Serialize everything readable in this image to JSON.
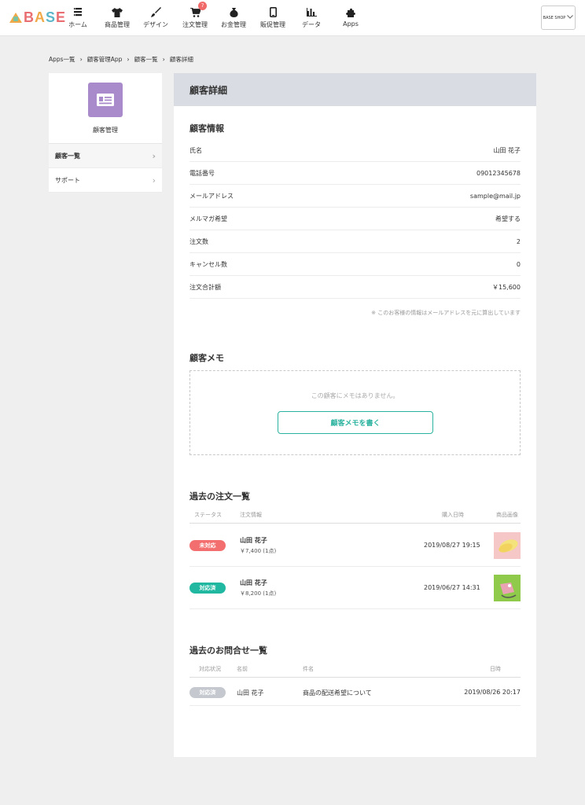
{
  "brand": {
    "logo_text": [
      "B",
      "A",
      "S",
      "E"
    ]
  },
  "nav": {
    "items": [
      {
        "label": "ホーム",
        "icon": "home-list-icon"
      },
      {
        "label": "商品管理",
        "icon": "tshirt-icon"
      },
      {
        "label": "デザイン",
        "icon": "brush-icon"
      },
      {
        "label": "注文管理",
        "icon": "cart-icon",
        "badge": "7"
      },
      {
        "label": "お金管理",
        "icon": "money-bag-icon"
      },
      {
        "label": "販促管理",
        "icon": "phone-icon"
      },
      {
        "label": "データ",
        "icon": "bar-chart-icon"
      },
      {
        "label": "Apps",
        "icon": "puzzle-icon"
      }
    ],
    "shop_button": "BASE SHOP"
  },
  "breadcrumb": [
    "Apps一覧",
    "顧客管理App",
    "顧客一覧",
    "顧客詳細"
  ],
  "sidebar": {
    "title": "顧客管理",
    "items": [
      {
        "label": "顧客一覧"
      },
      {
        "label": "サポート"
      }
    ]
  },
  "main": {
    "heading": "顧客詳細",
    "info": {
      "title": "顧客情報",
      "rows": [
        {
          "label": "氏名",
          "value": "山田 花子"
        },
        {
          "label": "電話番号",
          "value": "09012345678"
        },
        {
          "label": "メールアドレス",
          "value": "sample@mail.jp"
        },
        {
          "label": "メルマガ希望",
          "value": "希望する"
        },
        {
          "label": "注文数",
          "value": "2"
        },
        {
          "label": "キャンセル数",
          "value": "0"
        },
        {
          "label": "注文合計額",
          "value": "￥15,600"
        }
      ],
      "note": "※ このお客様の情報はメールアドレスを元に算出しています"
    },
    "memo": {
      "title": "顧客メモ",
      "empty_text": "この顧客にメモはありません。",
      "button": "顧客メモを書く"
    },
    "orders": {
      "title": "過去の注文一覧",
      "headers": [
        "ステータス",
        "注文情報",
        "購入日時",
        "商品画像"
      ],
      "rows": [
        {
          "status": "未対応",
          "name": "山田 花子",
          "price": "￥7,400 (1点)",
          "date": "2019/08/27 19:15",
          "status_color": "#f36f6f"
        },
        {
          "status": "対応済",
          "name": "山田 花子",
          "price": "￥8,200 (1点)",
          "date": "2019/06/27 14:31",
          "status_color": "#20b8a0"
        }
      ]
    },
    "inquiries": {
      "title": "過去のお問合せ一覧",
      "headers": [
        "対応状況",
        "名前",
        "件名",
        "日時"
      ],
      "rows": [
        {
          "status": "対応済",
          "name": "山田 花子",
          "subject": "商品の配送希望について",
          "date": "2019/08/26 20:17"
        }
      ]
    }
  },
  "colors": {
    "accent": "#2cb39f",
    "app_icon": "#a98bcb",
    "header_bg": "#d9dde3"
  }
}
